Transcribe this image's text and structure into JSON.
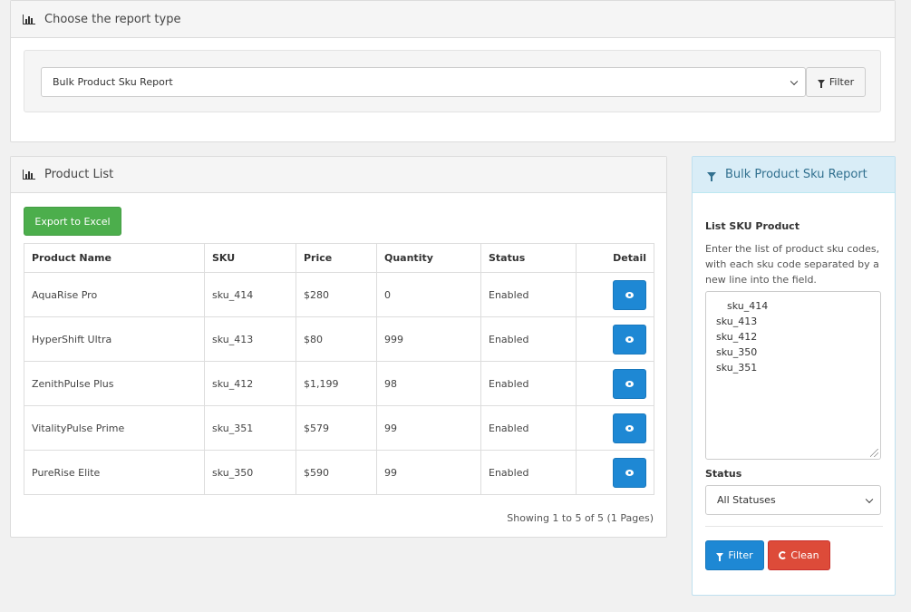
{
  "report_type": {
    "heading": "Choose the report type",
    "selected": "Bulk Product Sku Report",
    "filter_label": "Filter"
  },
  "product_list": {
    "heading": "Product List",
    "export_label": "Export to Excel",
    "columns": [
      "Product Name",
      "SKU",
      "Price",
      "Quantity",
      "Status",
      "Detail"
    ],
    "rows": [
      {
        "name": "AquaRise Pro",
        "sku": "sku_414",
        "price": "$280",
        "quantity": "0",
        "status": "Enabled"
      },
      {
        "name": "HyperShift Ultra",
        "sku": "sku_413",
        "price": "$80",
        "quantity": "999",
        "status": "Enabled"
      },
      {
        "name": "ZenithPulse Plus",
        "sku": "sku_412",
        "price": "$1,199",
        "quantity": "98",
        "status": "Enabled"
      },
      {
        "name": "VitalityPulse Prime",
        "sku": "sku_351",
        "price": "$579",
        "quantity": "99",
        "status": "Enabled"
      },
      {
        "name": "PureRise Elite",
        "sku": "sku_350",
        "price": "$590",
        "quantity": "99",
        "status": "Enabled"
      }
    ],
    "pager_text": "Showing 1 to 5 of 5 (1 Pages)"
  },
  "filter_panel": {
    "heading": "Bulk Product Sku Report",
    "sku_label": "List SKU Product",
    "sku_help": "Enter the list of product sku codes, with each sku code separated by a new line into the field.",
    "sku_lines": [
      "sku_414",
      "sku_413",
      "sku_412",
      "sku_350",
      "sku_351"
    ],
    "status_label": "Status",
    "status_selected": "All Statuses",
    "filter_label": "Filter",
    "clean_label": "Clean"
  },
  "colors": {
    "export_green": "#4cae4c",
    "primary_blue": "#1e88d4",
    "danger_red": "#dd4b39",
    "info_heading_bg": "#d9edf7"
  },
  "icons": [
    "bar-chart-icon",
    "filter-icon",
    "eye-icon",
    "refresh-icon",
    "chevron-down-icon"
  ]
}
